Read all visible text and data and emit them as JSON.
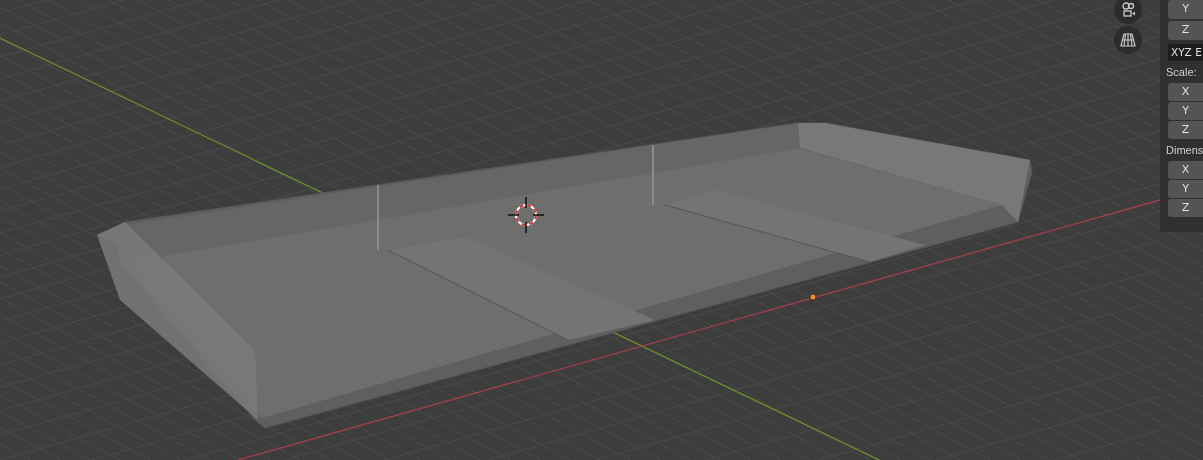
{
  "viewport": {
    "gizmo_buttons": [
      {
        "kind": "camera"
      },
      {
        "kind": "perspective"
      }
    ]
  },
  "sidebar": {
    "rotation": {
      "axes": [
        "Y",
        "Z"
      ],
      "mode": "XYZ E"
    },
    "scale": {
      "label": "Scale:",
      "axes": [
        "X",
        "Y",
        "Z"
      ]
    },
    "dimensions": {
      "label": "Dimens",
      "axes": [
        "X",
        "Y",
        "Z"
      ]
    }
  }
}
